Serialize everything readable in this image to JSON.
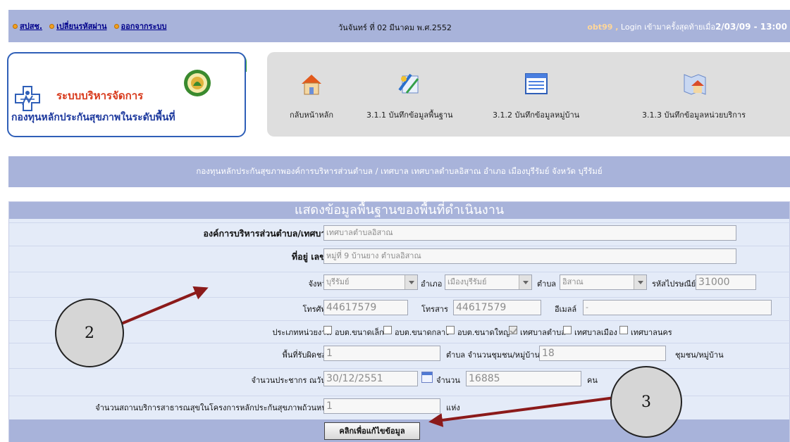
{
  "topbar": {
    "links": [
      "สปสช.",
      "เปลี่ยนรหัสผ่าน",
      "ออกจากระบบ"
    ],
    "date": "วันจันทร์ ที่ 02 มีนาคม พ.ศ.2552",
    "login_user": "obt99 ,",
    "login_text": " Login เข้ามาครั้งสุดท้ายเมื่อ",
    "login_time": "2/03/09 - 13:00"
  },
  "logo": {
    "title": "ระบบบริหารจัดการ",
    "subtitle": "กองทุนหลักประกันสุขภาพในระดับพื้นที่"
  },
  "nav": {
    "items": [
      {
        "label": "กลับหน้าหลัก",
        "icon": "home-icon"
      },
      {
        "label": "3.1.1 บันทึกข้อมูลพื้นฐาน",
        "icon": "edit-tools-icon"
      },
      {
        "label": "3.1.2 บันทึกข้อมูลหมู่บ้าน",
        "icon": "list-window-icon"
      },
      {
        "label": "3.1.3 บันทึกข้อมูลหน่วยบริการ",
        "icon": "map-house-icon"
      }
    ]
  },
  "org_banner": "กองทุนหลักประกันสุขภาพองค์การบริหารส่วนตำบล / เทศบาล เทศบาลตำบลอิสาณ  อำเภอ เมืองบุรีรัมย์   จังหวัด บุรีรัมย์",
  "form": {
    "title": "แสดงข้อมูลพื้นฐานของพื้นที่ดำเนินงาน",
    "org_label": "องค์การบริหารส่วนตำบล/เทศบาล",
    "org_value": "เทศบาลตำบลอิสาณ",
    "address_label": "ที่อยู่ เลขที่",
    "address_value": "หมู่ที่ 9  บ้านยาง  ตำบลอิสาณ",
    "province_label": "จังหวัด",
    "province_value": "บุรีรัมย์",
    "district_label": "อำเภอ",
    "district_value": "เมืองบุรีรัมย์",
    "subdistrict_label": "ตำบล",
    "subdistrict_value": "อิสาณ",
    "zip_label": "รหัสไปรษณีย์",
    "zip_value": "31000",
    "phone_label": "โทรศัพท์",
    "phone_value": "44617579",
    "fax_label": "โทรสาร",
    "fax_value": "44617579",
    "email_label": "อีเมลล์",
    "email_value": "-",
    "unit_type_label": "ประเภทหน่วยงาน",
    "unit_types": [
      {
        "label": "อบต.ขนาดเล็ก",
        "checked": false
      },
      {
        "label": "อบต.ขนาดกลาง",
        "checked": false
      },
      {
        "label": "อบต.ขนาดใหญ่",
        "checked": false
      },
      {
        "label": "เทศบาลตำบล",
        "checked": true
      },
      {
        "label": "เทศบาลเมือง",
        "checked": false
      },
      {
        "label": "เทศบาลนคร",
        "checked": false
      }
    ],
    "area_label": "พื้นที่รับผิดชอบ",
    "area_value": "1",
    "village_count_label": "ตำบล จำนวนชุมชน/หมู่บ้าน",
    "village_count_value": "18",
    "village_unit": "ชุมชน/หมู่บ้าน",
    "population_label": "จำนวนประชากร ณวันที่",
    "population_date": "30/12/2551",
    "population_count_label": "จำนวน",
    "population_count_value": "16885",
    "population_unit": "คน",
    "facility_label": "จำนวนสถานบริการสาธารณสุขในโครงการหลักประกันสุขภาพถ้วนหน้า",
    "facility_value": "1",
    "facility_unit": "แห่ง",
    "edit_button": "คลิกเพื่อแก้ไขข้อมูล"
  },
  "annotations": [
    "2",
    "3"
  ],
  "colors": {
    "header_bar": "#a8b3da",
    "form_bg": "#e4ebf8",
    "arrow": "#8b1a1a",
    "logo_red": "#d83a1c",
    "logo_blue": "#1e3a9e"
  }
}
